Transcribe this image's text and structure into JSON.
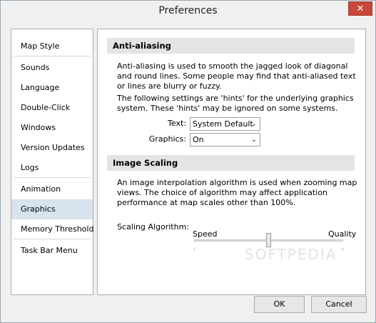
{
  "window": {
    "title": "Preferences",
    "close_glyph": "✕"
  },
  "sidebar": {
    "items": [
      {
        "label": "Map Style"
      },
      {
        "label": "Sounds"
      },
      {
        "label": "Language"
      },
      {
        "label": "Double-Click"
      },
      {
        "label": "Windows"
      },
      {
        "label": "Version Updates"
      },
      {
        "label": "Logs"
      },
      {
        "label": "Animation"
      },
      {
        "label": "Graphics",
        "selected": true
      },
      {
        "label": "Memory Threshold"
      },
      {
        "label": "Task Bar Menu"
      }
    ]
  },
  "anti_aliasing": {
    "header": "Anti-aliasing",
    "para1": "Anti-aliasing is used to smooth the jagged look of diagonal and round lines.  Some people may find that anti-aliased text or lines are blurry or fuzzy.",
    "para2": "The following settings are 'hints' for the underlying graphics system. These 'hints' may be ignored on some systems.",
    "text_label": "Text:",
    "text_value": "System Default",
    "graphics_label": "Graphics:",
    "graphics_value": "On"
  },
  "image_scaling": {
    "header": "Image Scaling",
    "para": "An image interpolation algorithm is used when zooming map views. The choice of algorithm may affect application performance at map scales other than 100%.",
    "scaling_label": "Scaling Algorithm:",
    "min_label": "Speed",
    "max_label": "Quality",
    "slider_value_fraction": 0.5
  },
  "watermark": "SOFTPEDIA",
  "buttons": {
    "ok": "OK",
    "cancel": "Cancel"
  },
  "colors": {
    "selected_bg": "#d7e3ef",
    "close_bg": "#c8473b"
  }
}
